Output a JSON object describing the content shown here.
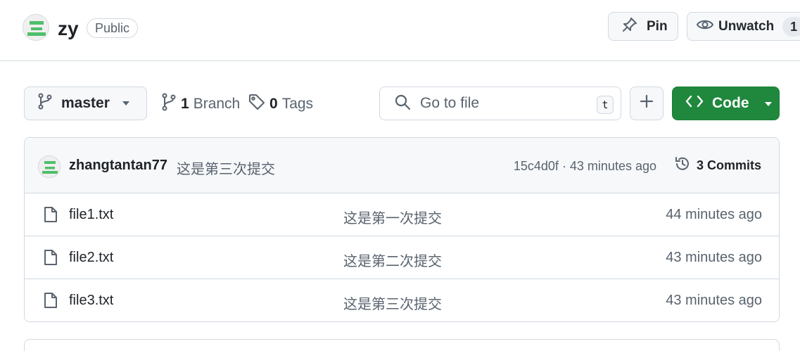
{
  "repo": {
    "name": "zy",
    "visibility": "Public",
    "pin_label": "Pin",
    "watch_label": "Unwatch",
    "watch_count": "1"
  },
  "toolbar": {
    "branch": "master",
    "branches_count": "1",
    "branches_label": "Branch",
    "tags_count": "0",
    "tags_label": "Tags",
    "search_placeholder": "Go to file",
    "search_shortcut": "t",
    "code_label": "Code"
  },
  "latest_commit": {
    "author": "zhangtantan77",
    "message": "这是第三次提交",
    "meta": "15c4d0f · 43 minutes ago",
    "commits_label": "3 Commits"
  },
  "files": [
    {
      "name": "file1.txt",
      "commit": "这是第一次提交",
      "time": "44 minutes ago"
    },
    {
      "name": "file2.txt",
      "commit": "这是第二次提交",
      "time": "43 minutes ago"
    },
    {
      "name": "file3.txt",
      "commit": "这是第三次提交",
      "time": "43 minutes ago"
    }
  ],
  "colors": {
    "accent_green": "#1f883d",
    "avatar_green": "#4fbf6a",
    "border": "#d1d9e0"
  },
  "icons": [
    "repo-avatar-icon",
    "pin-icon",
    "eye-icon",
    "git-branch-icon",
    "tag-icon",
    "search-icon",
    "plus-icon",
    "code-icon",
    "history-icon",
    "file-icon",
    "triangle-down-icon"
  ]
}
